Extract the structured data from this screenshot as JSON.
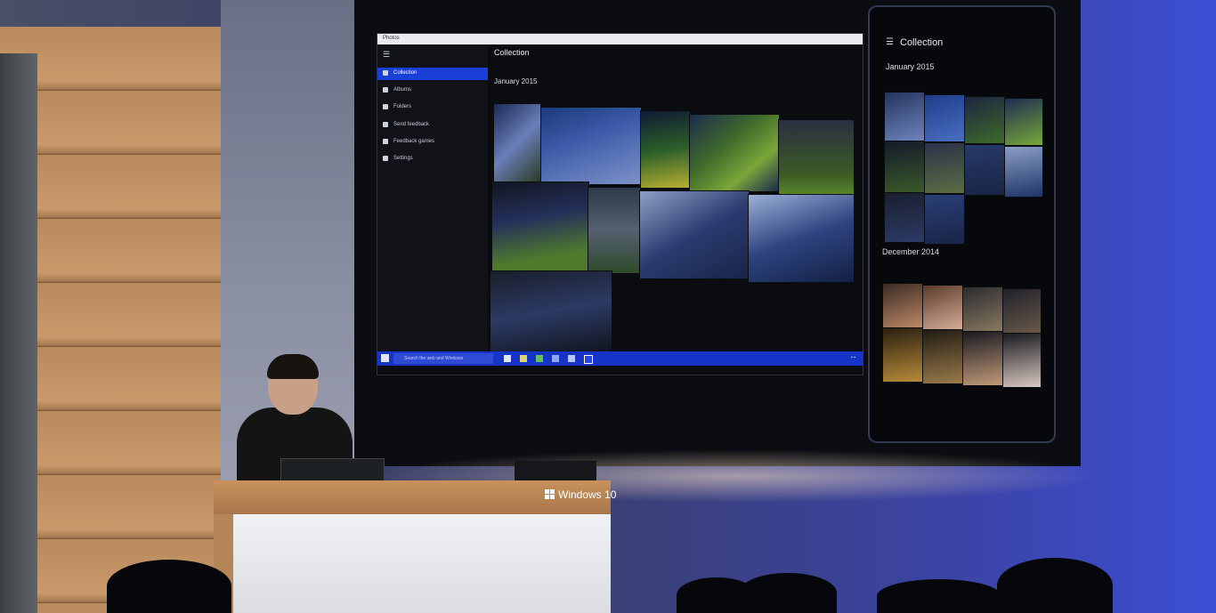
{
  "desktop": {
    "title_bar": "Photos",
    "app_title": "Collection",
    "month_label": "January 2015",
    "sidebar": [
      {
        "label": "Collection",
        "active": true
      },
      {
        "label": "Albums"
      },
      {
        "label": "Folders"
      },
      {
        "label": "Send feedback"
      },
      {
        "label": "Feedback games"
      },
      {
        "label": "Settings"
      }
    ],
    "taskbar": {
      "search_placeholder": "Search the web and Windows"
    }
  },
  "phone": {
    "title": "Collection",
    "month_1": "January 2015",
    "month_2": "December 2014"
  },
  "podium": {
    "brand": "Windows 10"
  },
  "colors": {
    "accent": "#1a3fd6",
    "taskbar": "#1734c8",
    "stage_blue": "#3c4fd4"
  }
}
